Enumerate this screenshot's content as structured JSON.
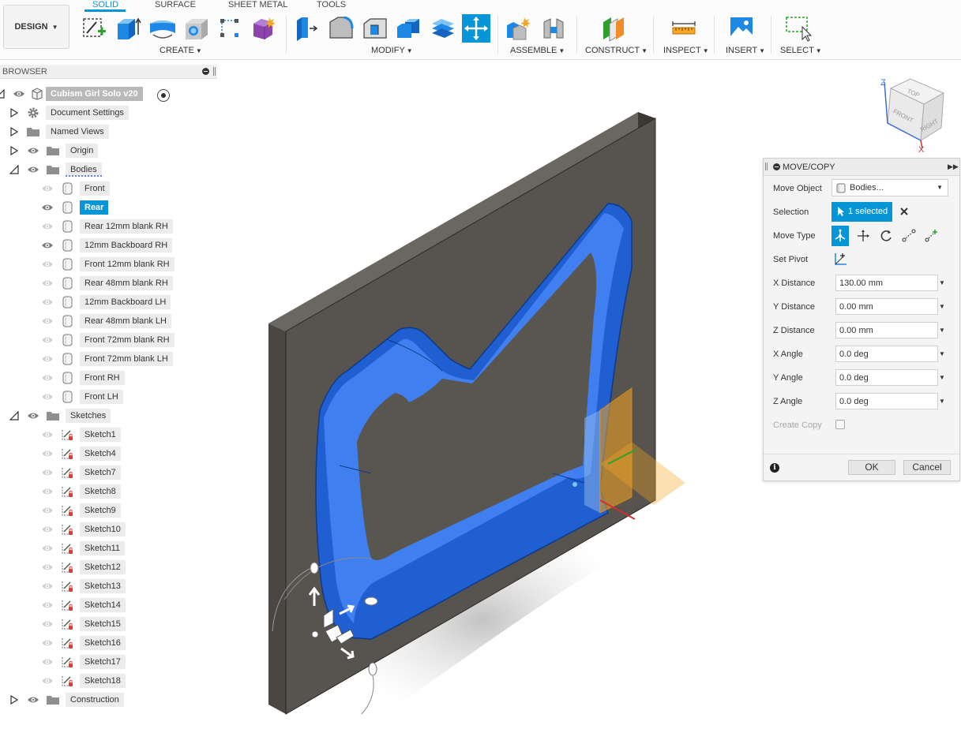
{
  "toolbar": {
    "design_label": "DESIGN",
    "tabs": [
      "SOLID",
      "SURFACE",
      "SHEET METAL",
      "TOOLS"
    ],
    "groups": [
      "CREATE",
      "MODIFY",
      "ASSEMBLE",
      "CONSTRUCT",
      "INSPECT",
      "INSERT",
      "SELECT"
    ],
    "accent": "#0696d7"
  },
  "browser": {
    "title": "BROWSER",
    "root_label": "Cubism Girl Solo v20",
    "items": [
      {
        "label": "Document Settings",
        "icon": "gear-icon"
      },
      {
        "label": "Named Views",
        "icon": "folder-icon"
      },
      {
        "label": "Origin",
        "icon": "folder-icon"
      },
      {
        "label": "Bodies",
        "icon": "folder-icon"
      }
    ],
    "bodies": [
      {
        "label": "Front",
        "visible": false,
        "selected": false
      },
      {
        "label": "Rear",
        "visible": true,
        "selected": true
      },
      {
        "label": "Rear 12mm blank RH",
        "visible": false,
        "selected": false
      },
      {
        "label": "12mm Backboard RH",
        "visible": true,
        "selected": false
      },
      {
        "label": "Front 12mm blank RH",
        "visible": false,
        "selected": false
      },
      {
        "label": "Rear 48mm blank RH",
        "visible": false,
        "selected": false
      },
      {
        "label": "12mm Backboard LH",
        "visible": false,
        "selected": false
      },
      {
        "label": "Rear 48mm blank LH",
        "visible": false,
        "selected": false
      },
      {
        "label": "Front  72mm blank RH",
        "visible": false,
        "selected": false
      },
      {
        "label": "Front  72mm blank LH",
        "visible": false,
        "selected": false
      },
      {
        "label": "Front RH",
        "visible": false,
        "selected": false
      },
      {
        "label": "Front LH",
        "visible": false,
        "selected": false
      }
    ],
    "sketches_label": "Sketches",
    "sketches": [
      "Sketch1",
      "Sketch4",
      "Sketch7",
      "Sketch8",
      "Sketch9",
      "Sketch10",
      "Sketch11",
      "Sketch12",
      "Sketch13",
      "Sketch14",
      "Sketch15",
      "Sketch16",
      "Sketch17",
      "Sketch18"
    ],
    "construction_label": "Construction"
  },
  "viewcube": {
    "top": "TOP",
    "front": "FRONT",
    "right": "RIGHT",
    "z": "Z",
    "x": "X"
  },
  "panel": {
    "title": "MOVE/COPY",
    "move_object_label": "Move Object",
    "move_object_value": "Bodies...",
    "selection_label": "Selection",
    "selection_value": "1 selected",
    "move_type_label": "Move Type",
    "set_pivot_label": "Set Pivot",
    "fields": [
      {
        "label": "X Distance",
        "value": "130.00 mm"
      },
      {
        "label": "Y Distance",
        "value": "0.00 mm"
      },
      {
        "label": "Z Distance",
        "value": "0.00 mm"
      },
      {
        "label": "X Angle",
        "value": "0.0 deg"
      },
      {
        "label": "Y Angle",
        "value": "0.0 deg"
      },
      {
        "label": "Z Angle",
        "value": "0.0 deg"
      }
    ],
    "create_copy_label": "Create Copy",
    "create_copy_checked": false,
    "info_symbol": "i",
    "ok_label": "OK",
    "cancel_label": "Cancel"
  }
}
